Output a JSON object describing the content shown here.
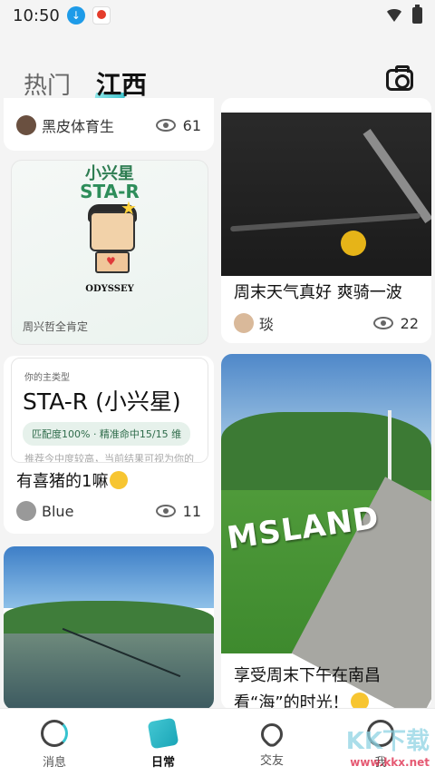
{
  "status_bar": {
    "time": "10:50"
  },
  "header": {
    "tabs": [
      {
        "label": "热门"
      },
      {
        "label": "江西"
      }
    ]
  },
  "feed": {
    "left": [
      {
        "author": "黑皮体育生",
        "views": "61"
      },
      {
        "card_title": "小兴星",
        "card_type": "STA-R",
        "brand": "ODYSSEY",
        "caption": "周兴哲全肯定"
      },
      {
        "label_small": "你的主类型",
        "result": "STA-R (小兴星)",
        "chip": "匹配度100% · 精准命中15/15 维",
        "faded": "推荐今中度较高，当前结果可视为你的",
        "title": "有喜猪的1嘛",
        "author": "Blue",
        "views": "11"
      },
      {
        "image": "lake"
      }
    ],
    "right": [
      {
        "title": "周末天气真好 爽骑一波",
        "author": "琰",
        "views": "22"
      },
      {
        "sign": "MSLAND",
        "title": "享受周末下午在南昌看“海”的时光！"
      }
    ]
  },
  "nav": {
    "items": [
      {
        "label": "消息",
        "icon": "message-icon"
      },
      {
        "label": "日常",
        "icon": "daily-icon",
        "active": true
      },
      {
        "label": "交友",
        "icon": "friends-icon"
      },
      {
        "label": "我",
        "icon": "me-icon"
      }
    ]
  },
  "watermark": {
    "brand": "KK下载",
    "url": "www.kkx.net"
  },
  "colors": {
    "accent": "#1aa5b7",
    "background": "#f4f4f4"
  }
}
